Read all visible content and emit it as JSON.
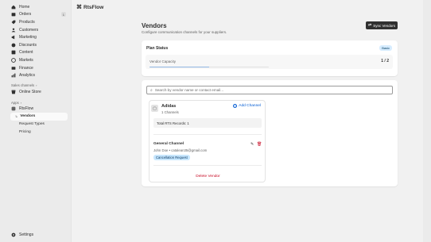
{
  "sidebar": {
    "items": [
      {
        "label": "Home",
        "icon": "home-icon"
      },
      {
        "label": "Orders",
        "icon": "orders-icon",
        "count": "1"
      },
      {
        "label": "Products",
        "icon": "products-icon"
      },
      {
        "label": "Customers",
        "icon": "customers-icon"
      },
      {
        "label": "Marketing",
        "icon": "marketing-icon"
      },
      {
        "label": "Discounts",
        "icon": "discounts-icon"
      },
      {
        "label": "Content",
        "icon": "content-icon"
      },
      {
        "label": "Markets",
        "icon": "markets-icon"
      },
      {
        "label": "Finance",
        "icon": "finance-icon"
      },
      {
        "label": "Analytics",
        "icon": "analytics-icon"
      }
    ],
    "sales_channels_label": "Sales channels",
    "online_store_label": "Online Store",
    "apps_label": "Apps",
    "app_name": "RtsFlow",
    "app_sub_items": [
      "Vendors",
      "Request Types",
      "Pricing"
    ],
    "settings_label": "Settings"
  },
  "app": {
    "brand": "RtsFlow"
  },
  "page": {
    "title": "Vendors",
    "subtitle": "Configure communication channels for your suppliers.",
    "sync_button": "Sync Vendors"
  },
  "plan": {
    "title": "Plan Status",
    "badge": "Basic",
    "capacity_label": "Vendor Capacity",
    "capacity_value": "1 / 2",
    "capacity_fraction": 0.5
  },
  "search": {
    "placeholder": "Search by vendor name or contact email..."
  },
  "vendor": {
    "name": "Adidas",
    "channels": "1 Channels",
    "add_channel": "Add Channel",
    "records": "Total RTS Records: 1",
    "channel_title": "General Channel",
    "channel_contact": "John Doe • catalean35@gmail.com",
    "channel_badge": "Cancellation Request",
    "delete_label": "Delete Vendor"
  },
  "colors": {
    "accent": "#005bd3",
    "danger": "#c70a24",
    "badge_blue": "#c8e7ff",
    "button_dark": "#303030"
  }
}
